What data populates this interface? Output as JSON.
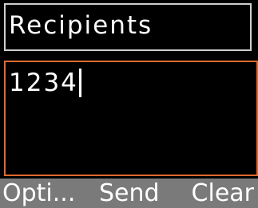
{
  "header": {
    "title": "Recipients"
  },
  "recipient_input": {
    "value": "1234"
  },
  "softkeys": {
    "left": "Opti...",
    "center": "Send",
    "right": "Clear"
  },
  "colors": {
    "background": "#000000",
    "header_border": "#cfcfcf",
    "focus_border": "#e06a2e",
    "softkey_bar": "#7a7a7a",
    "text": "#ffffff"
  }
}
